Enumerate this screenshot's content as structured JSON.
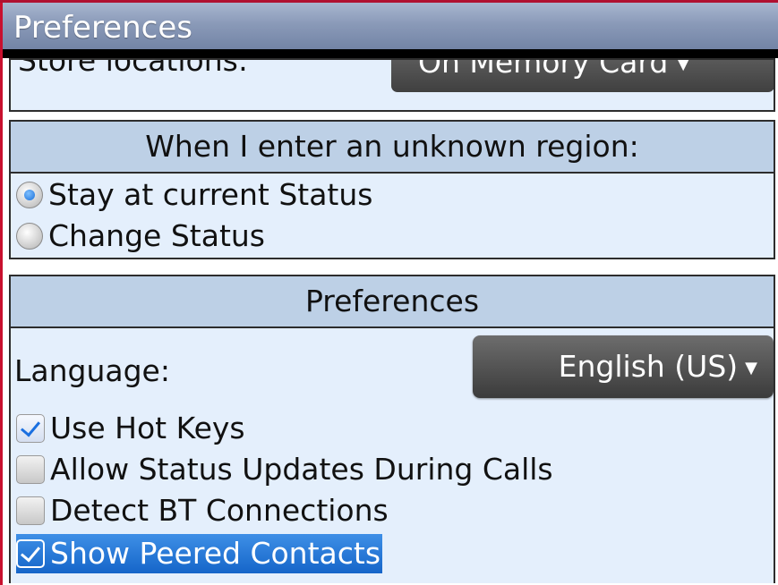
{
  "title_bar": {
    "title": "Preferences"
  },
  "store_section": {
    "label": "Store locations:",
    "dropdown_value": "On Memory Card",
    "dropdown_arrow": "▼"
  },
  "region_section": {
    "header": "When I enter an unknown region:",
    "options": [
      {
        "label": "Stay at current Status",
        "selected": true
      },
      {
        "label": "Change Status",
        "selected": false
      }
    ]
  },
  "preferences_section": {
    "header": "Preferences",
    "language_label": "Language:",
    "language_value": "English (US)",
    "language_arrow": "▼",
    "checkboxes": [
      {
        "label": "Use Hot Keys",
        "checked": true
      },
      {
        "label": "Allow Status Updates During Calls",
        "checked": false
      },
      {
        "label": "Detect BT Connections",
        "checked": false
      },
      {
        "label": "Show Peered Contacts",
        "checked": true,
        "focused": true
      }
    ]
  },
  "colors": {
    "title_bar": "#8a9ab8",
    "section_bg": "#e4effc",
    "header_bg": "#bdd0e6",
    "highlight": "#1f74d6",
    "dropdown": "#4a4a4a"
  }
}
